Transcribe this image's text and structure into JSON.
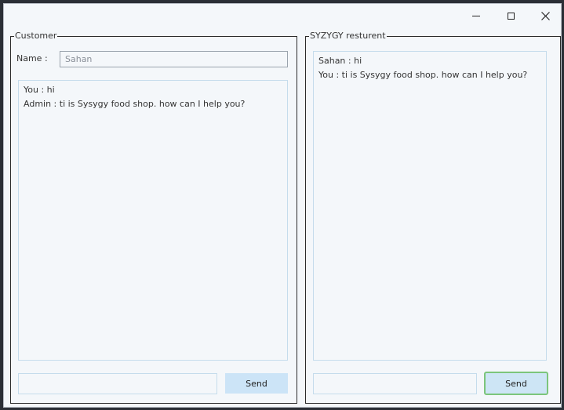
{
  "window": {
    "controls": {
      "minimize": "minimize-icon",
      "maximize": "maximize-icon",
      "close": "close-icon"
    }
  },
  "customer": {
    "group_title": "Customer",
    "name_label": "Name :",
    "name_value": "Sahan",
    "messages": [
      "You : hi",
      "Admin : ti is Sysygy food shop. how can I help you?"
    ],
    "message_input": "",
    "send_label": "Send"
  },
  "restaurant": {
    "group_title": "SYZYGY resturent",
    "messages": [
      "Sahan : hi",
      "You : ti is Sysygy food shop. how can I help you?"
    ],
    "message_input": "",
    "send_label": "Send"
  },
  "colors": {
    "focus_border": "#7cc57b",
    "button_bg": "#cce4f7",
    "field_border": "#c5dcec"
  }
}
